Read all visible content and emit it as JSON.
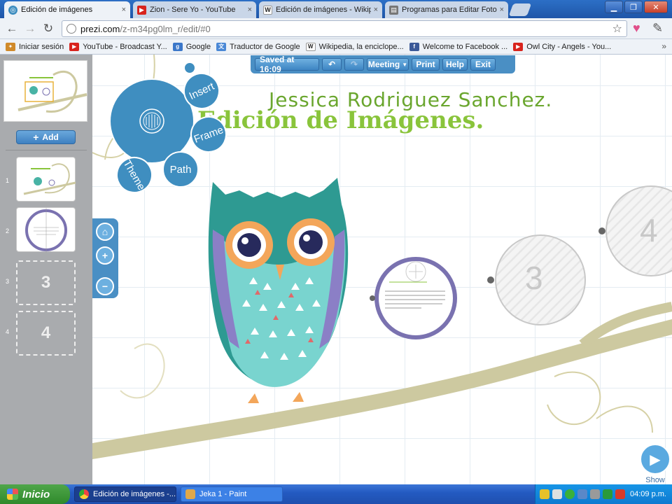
{
  "browser": {
    "tabs": [
      {
        "label": "Edición de imágenes",
        "icon": "prezi-icon",
        "active": true
      },
      {
        "label": "Zion - Sere Yo - YouTube",
        "icon": "youtube-icon",
        "active": false
      },
      {
        "label": "Edición de imágenes - Wikipe",
        "icon": "wikipedia-icon",
        "active": false
      },
      {
        "label": "Programas para Editar Fotos",
        "icon": "page-icon",
        "active": false
      }
    ],
    "close_glyph": "×",
    "window_controls": {
      "minimize": "▁",
      "maximize": "❐",
      "close": "✕"
    },
    "url_host": "prezi.com",
    "url_path": "/z-m34pg0lm_r/edit/#0",
    "bookmarks": [
      {
        "label": "Iniciar sesión",
        "icon": "puzzle-icon",
        "color": "#d08a2a"
      },
      {
        "label": "YouTube - Broadcast Y...",
        "icon": "youtube-icon",
        "color": "#d8231d"
      },
      {
        "label": "Google",
        "icon": "google-icon",
        "color": "#3b77c9"
      },
      {
        "label": "Traductor de Google",
        "icon": "translate-icon",
        "color": "#4a88d6"
      },
      {
        "label": "Wikipedia, la enciclope...",
        "icon": "wikipedia-icon",
        "color": "#555555"
      },
      {
        "label": "Welcome to Facebook ...",
        "icon": "facebook-icon",
        "color": "#3b5998"
      },
      {
        "label": "Owl City - Angels - You...",
        "icon": "youtube-icon",
        "color": "#d8231d"
      }
    ],
    "bookmarks_more": "»"
  },
  "prezi": {
    "toolbar": {
      "saved": "Saved at 16:09",
      "undo": "↶",
      "redo": "↷",
      "meeting": "Meeting",
      "print": "Print",
      "help": "Help",
      "exit": "Exit"
    },
    "add_label": "Add",
    "slides": [
      {
        "num": "1",
        "type": "filled"
      },
      {
        "num": "2",
        "type": "filled"
      },
      {
        "num": "3",
        "type": "empty",
        "label": "3"
      },
      {
        "num": "4",
        "type": "empty",
        "label": "4"
      }
    ],
    "bubble_menu": {
      "insert": "Insert",
      "frame": "Frame",
      "theme": "Theme",
      "path": "Path"
    },
    "canvas": {
      "title": "Edición de Imágenes.",
      "author": "Jessica Rodriguez Sanchez.",
      "frame3_label": "3",
      "frame4_label": "4"
    },
    "show_label": "Show",
    "colors": {
      "accent": "#4a8fc4",
      "green": "#89c43b",
      "branch": "#cdc9a0"
    }
  },
  "taskbar": {
    "start": "Inicio",
    "tasks": [
      {
        "label": "Edición de imágenes -...",
        "active": true
      },
      {
        "label": "Jeka 1 - Paint",
        "active": false
      }
    ],
    "clock": "04:09 p.m."
  }
}
